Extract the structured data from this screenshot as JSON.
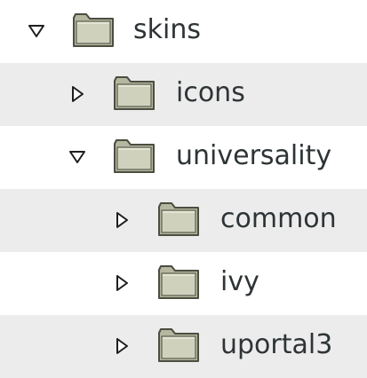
{
  "tree": {
    "nodes": [
      {
        "label": "skins",
        "expanded": true,
        "toggle_icon": "triangle-down-icon",
        "icon": "folder-icon"
      },
      {
        "label": "icons",
        "expanded": false,
        "toggle_icon": "triangle-right-icon",
        "icon": "folder-icon"
      },
      {
        "label": "universality",
        "expanded": true,
        "toggle_icon": "triangle-down-icon",
        "icon": "folder-icon"
      },
      {
        "label": "common",
        "expanded": false,
        "toggle_icon": "triangle-right-icon",
        "icon": "folder-icon"
      },
      {
        "label": "ivy",
        "expanded": false,
        "toggle_icon": "triangle-right-icon",
        "icon": "folder-icon"
      },
      {
        "label": "uportal3",
        "expanded": false,
        "toggle_icon": "triangle-right-icon",
        "icon": "folder-icon"
      }
    ]
  },
  "colors": {
    "row_shade": "#ececec",
    "text": "#2e3436",
    "folder_body": "#c8c9b4",
    "folder_outline": "#4b4d40"
  }
}
